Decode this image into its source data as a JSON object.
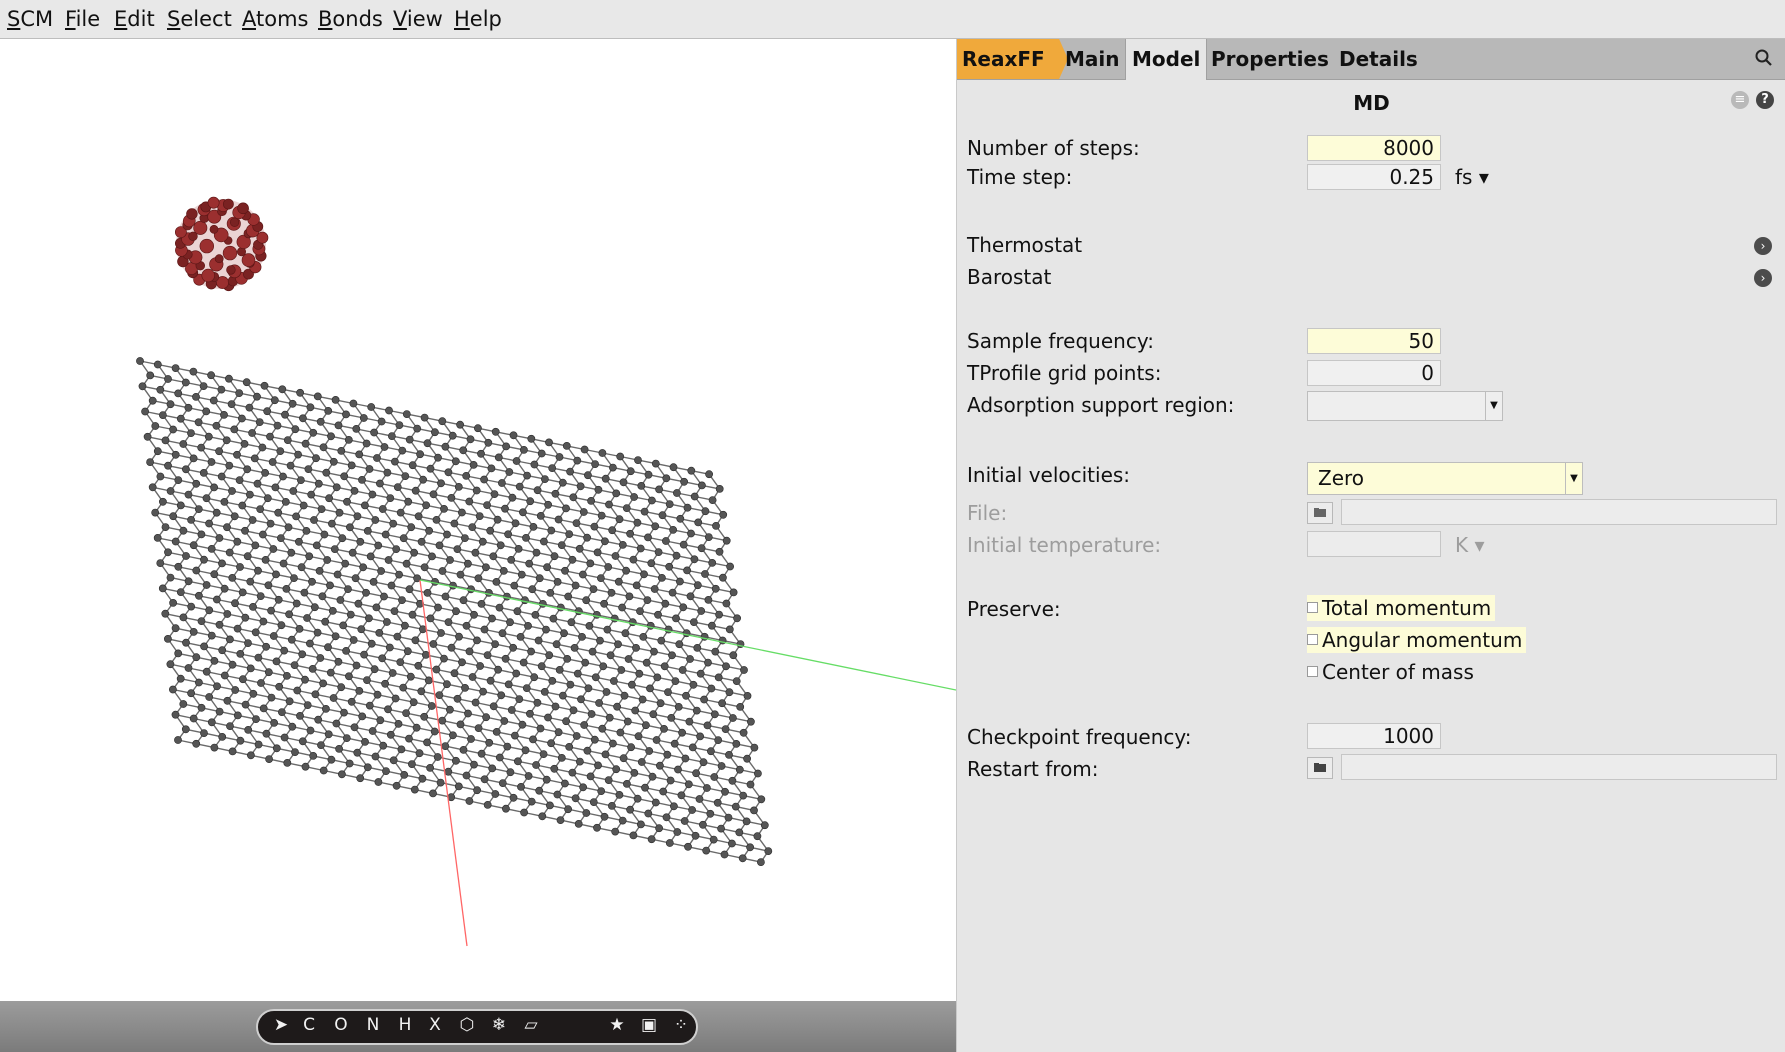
{
  "menubar": {
    "items": [
      "SCM",
      "File",
      "Edit",
      "Select",
      "Atoms",
      "Bonds",
      "View",
      "Help"
    ]
  },
  "tabs": {
    "items": [
      "ReaxFF",
      "Main",
      "Model",
      "Properties",
      "Details"
    ],
    "active": "Model",
    "accent_color": "#f0a93b"
  },
  "panel": {
    "section_title": "MD",
    "number_of_steps": {
      "label": "Number of steps:",
      "value": "8000"
    },
    "time_step": {
      "label": "Time step:",
      "value": "0.25",
      "unit": "fs ▾"
    },
    "thermostat": {
      "label": "Thermostat"
    },
    "barostat": {
      "label": "Barostat"
    },
    "sample_frequency": {
      "label": "Sample frequency:",
      "value": "50"
    },
    "tprofile_grid_points": {
      "label": "TProfile grid points:",
      "value": "0"
    },
    "adsorption_support_region": {
      "label": "Adsorption support region:",
      "value": ""
    },
    "initial_velocities": {
      "label": "Initial velocities:",
      "value": "Zero"
    },
    "file": {
      "label": "File:",
      "value": ""
    },
    "initial_temperature": {
      "label": "Initial temperature:",
      "value": "",
      "unit": "K ▾"
    },
    "preserve": {
      "label": "Preserve:",
      "options": [
        {
          "label": "Total momentum",
          "checked": false
        },
        {
          "label": "Angular momentum",
          "checked": false
        },
        {
          "label": "Center of mass",
          "checked": false
        }
      ]
    },
    "checkpoint_frequency": {
      "label": "Checkpoint frequency:",
      "value": "1000"
    },
    "restart_from": {
      "label": "Restart from:",
      "value": ""
    }
  },
  "toolbar": {
    "tools": [
      "C",
      "O",
      "N",
      "H",
      "X"
    ]
  },
  "colors": {
    "highlight_field": "#fdfcd8",
    "atom_carbon": "#555555",
    "fullerene": "#8e2b2b",
    "axis_x": "#ff6666",
    "axis_y": "#66dd66"
  }
}
